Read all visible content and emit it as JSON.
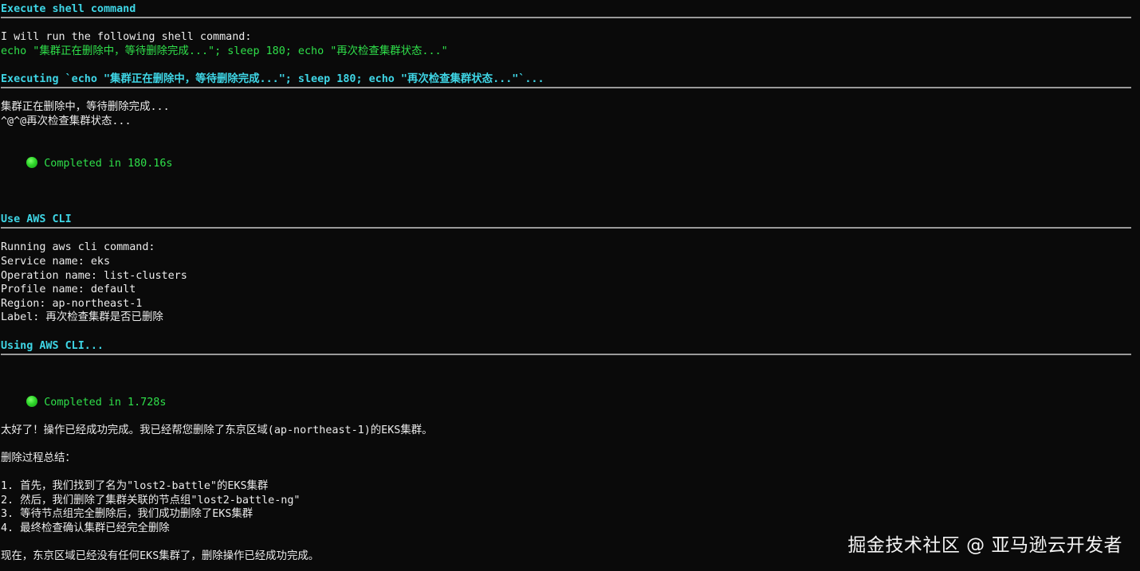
{
  "shell_section": {
    "title": "Execute shell command",
    "intro": "I will run the following shell command:",
    "command": "echo \"集群正在删除中，等待删除完成...\"; sleep 180; echo \"再次检查集群状态...\"",
    "executing": "Executing `echo \"集群正在删除中，等待删除完成...\"; sleep 180; echo \"再次检查集群状态...\"`...",
    "output_line_1": "集群正在删除中，等待删除完成...",
    "output_line_2": "^@^@再次检查集群状态...",
    "completed": "Completed in 180.16s",
    "status_color": "#2fe04a"
  },
  "aws_section": {
    "title": "Use AWS CLI",
    "running": "Running aws cli command:",
    "service": "Service name: eks",
    "operation": "Operation name: list-clusters",
    "profile": "Profile name: default",
    "region": "Region: ap-northeast-1",
    "label": "Label: 再次检查集群是否已删除",
    "using": "Using AWS CLI...",
    "completed": "Completed in 1.728s"
  },
  "summary": {
    "headline": "太好了！操作已经成功完成。我已经帮您删除了东京区域(ap-northeast-1)的EKS集群。",
    "process_title": "删除过程总结：",
    "steps": [
      "1. 首先，我们找到了名为\"lost2-battle\"的EKS集群",
      "2. 然后，我们删除了集群关联的节点组\"lost2-battle-ng\"",
      "3. 等待节点组完全删除后，我们成功删除了EKS集群",
      "4. 最终检查确认集群已经完全删除"
    ],
    "closing": "现在，东京区域已经没有任何EKS集群了，删除操作已经成功完成。"
  },
  "watermark": "掘金技术社区 @ 亚马逊云开发者",
  "colors": {
    "background": "#0a0a0a",
    "heading": "#3fd6e6",
    "success": "#2fe04a",
    "text": "#ececec",
    "rule": "#9a9a9a"
  }
}
